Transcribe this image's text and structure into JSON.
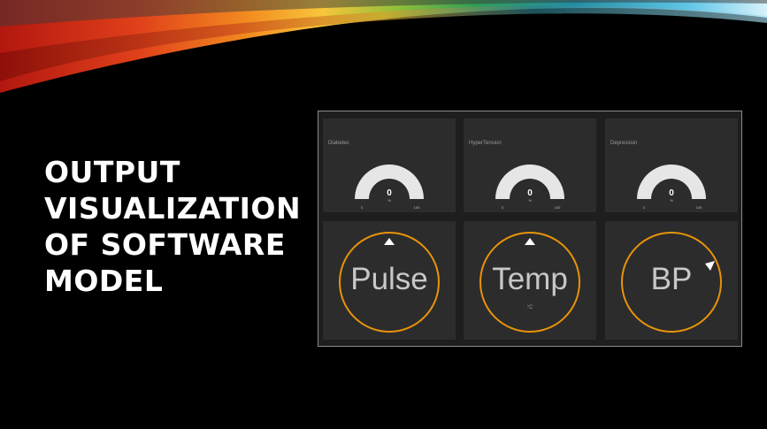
{
  "slide": {
    "title_lines": [
      "OUTPUT",
      "VISUALIZATION",
      "OF SOFTWARE",
      "MODEL"
    ]
  },
  "gauges": [
    {
      "label": "Diabetes",
      "value": "0",
      "unit": "%",
      "min": "0",
      "max": "100",
      "level": 0
    },
    {
      "label": "HyperTension",
      "value": "0",
      "unit": "%",
      "min": "0",
      "max": "100",
      "level": 0
    },
    {
      "label": "Depression",
      "value": "0",
      "unit": "%",
      "min": "0",
      "max": "100",
      "level": 0
    }
  ],
  "dials": [
    {
      "label": "Pulse",
      "unit": ""
    },
    {
      "label": "Temp",
      "unit": "°C"
    },
    {
      "label": "BP",
      "unit": ""
    }
  ],
  "colors": {
    "background": "#000000",
    "panel": "#2c2c2c",
    "gauge_arc": "#e6e6e6",
    "ring": "#e8930a",
    "marker": "#ffffff"
  }
}
